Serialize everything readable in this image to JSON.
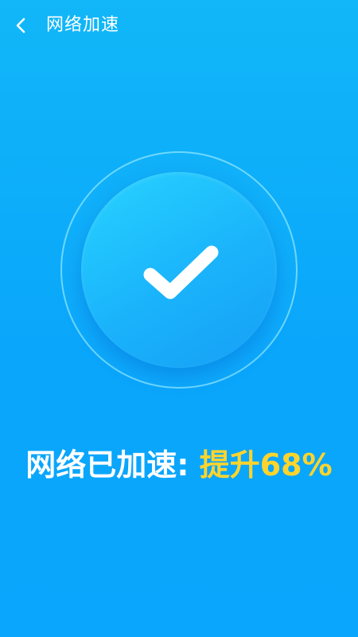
{
  "header": {
    "title": "网络加速",
    "back_icon": "chevron-left-icon"
  },
  "status": {
    "icon": "check-icon",
    "label": "网络已加速:",
    "value": "提升68%",
    "value_color": "#ffd42c",
    "accent": "#11b7f8"
  }
}
